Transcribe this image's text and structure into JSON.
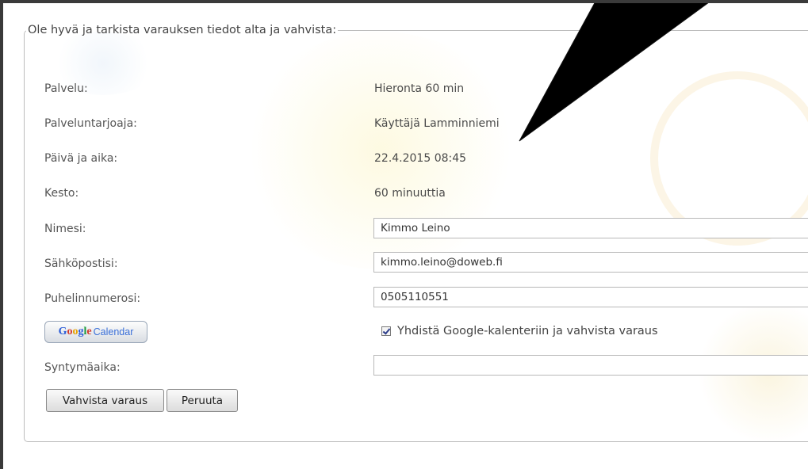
{
  "form": {
    "legend": "Ole hyvä ja tarkista varauksen tiedot alta ja vahvista:",
    "rows": [
      {
        "label": "Palvelu:",
        "value": "Hieronta 60 min"
      },
      {
        "label": "Palveluntarjoaja:",
        "value": "Käyttäjä Lamminniemi"
      },
      {
        "label": "Päivä ja aika:",
        "value": "22.4.2015 08:45"
      },
      {
        "label": "Kesto:",
        "value": "60 minuuttia"
      }
    ],
    "name": {
      "label": "Nimesi:",
      "value": "Kimmo Leino"
    },
    "email": {
      "label": "Sähköpostisi:",
      "value": "kimmo.leino@doweb.fi"
    },
    "phone": {
      "label": "Puhelinnumerosi:",
      "value": "0505110551"
    },
    "google": {
      "button_google": "Google",
      "button_calendar": "Calendar",
      "checkbox_label": "Yhdistä Google-kalenteriin ja vahvista varaus",
      "checked": true
    },
    "birth": {
      "label": "Syntymäaika:",
      "value": ""
    },
    "buttons": {
      "confirm": "Vahvista varaus",
      "cancel": "Peruuta"
    }
  },
  "colors": {
    "arrow": "#000000",
    "frame": "#3a3a3a",
    "border": "#bdbdbd"
  }
}
